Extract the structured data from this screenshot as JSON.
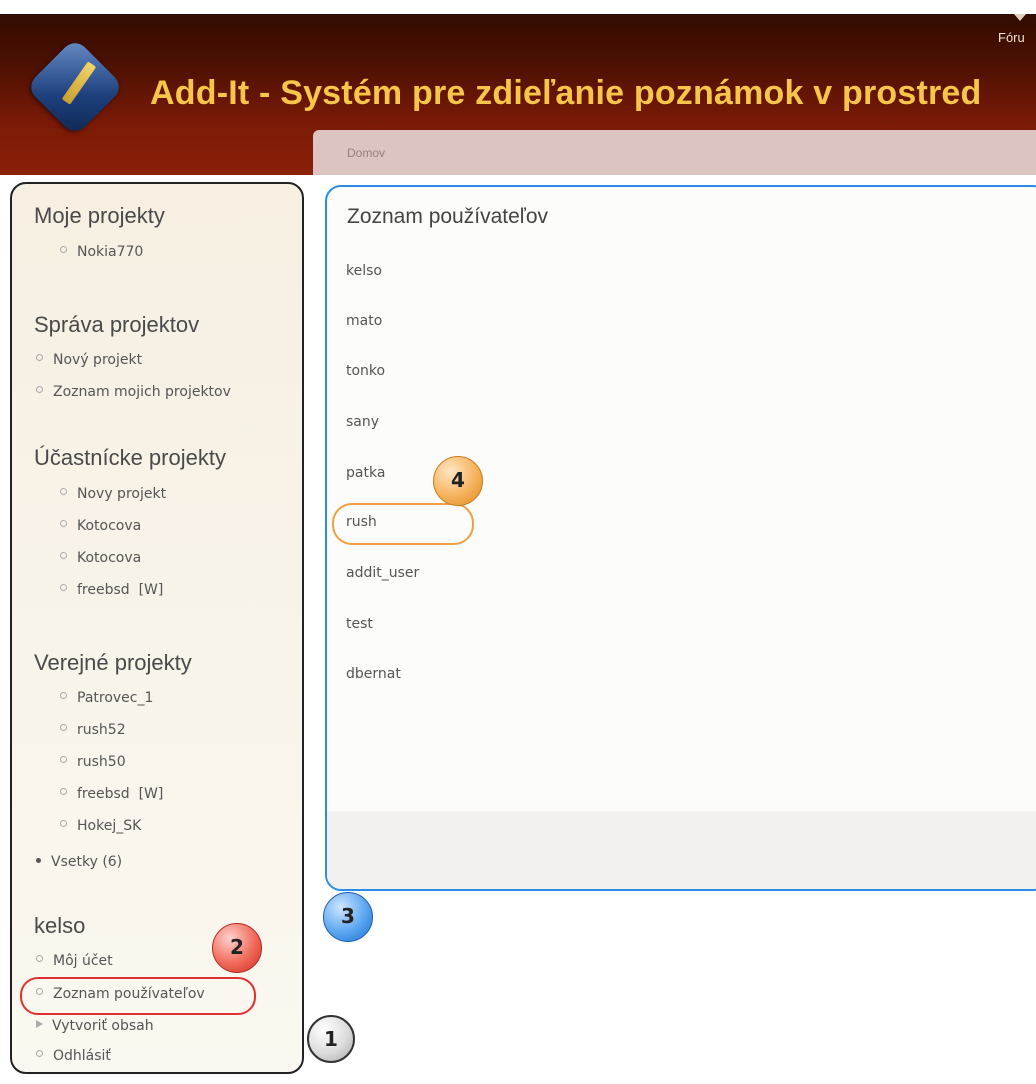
{
  "header": {
    "app_title": "Add-It - Systém pre zdieľanie poznámok v prostred",
    "forum_link": "Fóru"
  },
  "breadcrumb": {
    "home": "Domov"
  },
  "sidebar": {
    "my_projects": {
      "title": "Moje projekty",
      "items": [
        "Nokia770"
      ]
    },
    "project_admin": {
      "title": "Správa projektov",
      "items": [
        "Nový projekt",
        "Zoznam mojich projektov"
      ]
    },
    "participant_projects": {
      "title": "Účastnícke projekty",
      "items": [
        "Novy projekt",
        "Kotocova",
        "Kotocova",
        "freebsd  [W]"
      ]
    },
    "public_projects": {
      "title": "Verejné projekty",
      "items": [
        "Patrovec_1",
        "rush52",
        "rush50",
        "freebsd  [W]",
        "Hokej_SK"
      ],
      "all_link": "Vsetky (6)"
    },
    "user_menu": {
      "title": "kelso",
      "items": [
        "Môj účet",
        "Zoznam používateľov",
        "Vytvoriť obsah",
        "Odhlásiť"
      ]
    }
  },
  "main": {
    "title": "Zoznam používateľov",
    "users": [
      "kelso",
      "mato",
      "tonko",
      "sany",
      "patka",
      "rush",
      "addit_user",
      "test",
      "dbernat"
    ]
  },
  "annotations": {
    "badge_1": "1",
    "badge_2": "2",
    "badge_3": "3",
    "badge_4": "4"
  },
  "colors": {
    "header_dark": "#2b0b00",
    "header_red": "#8a2008",
    "title_gold": "#f6c54a",
    "panel_border_blue": "#2b8ee6",
    "highlight_red": "#e03030",
    "highlight_orange": "#f0a040"
  }
}
